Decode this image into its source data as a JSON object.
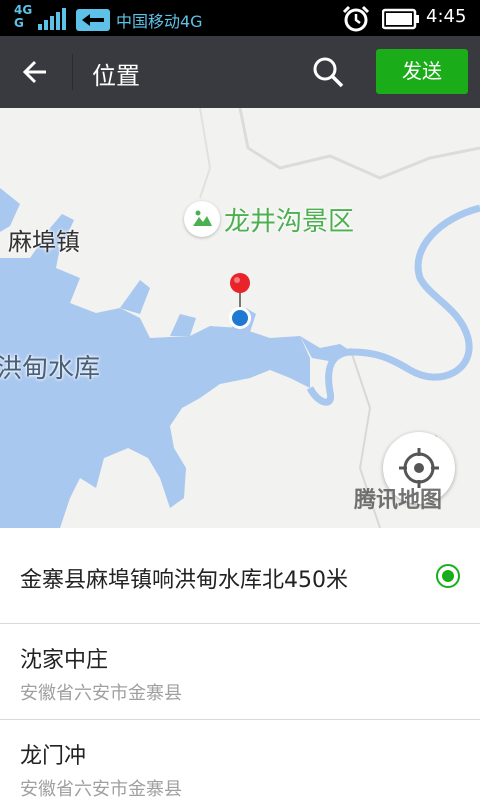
{
  "status_bar": {
    "network": "4G",
    "network_sub": "G",
    "carrier": "中国移动4G",
    "time": "4:45",
    "icons": [
      "signal-icon",
      "data-swap-icon",
      "alarm-icon",
      "battery-icon"
    ]
  },
  "header": {
    "title": "位置",
    "send_label": "发送",
    "icons": [
      "back-arrow-icon",
      "search-icon"
    ]
  },
  "map": {
    "poi_label": "龙井沟景区",
    "town_label": "麻埠镇",
    "reservoir_label": "洪甸水库",
    "edge_label": "地",
    "watermark": "腾讯地图",
    "colors": {
      "water": "#a9c8ef",
      "land": "#f2f2f0",
      "pin": "#e8232a",
      "poi_text": "#4caf50"
    }
  },
  "places": [
    {
      "title": "金寨县麻埠镇响洪甸水库北450米",
      "subtitle": "",
      "selected": true
    },
    {
      "title": "沈家中庄",
      "subtitle": "安徽省六安市金寨县",
      "selected": false
    },
    {
      "title": "龙门冲",
      "subtitle": "安徽省六安市金寨县",
      "selected": false
    }
  ],
  "accent_color": "#1aad19"
}
